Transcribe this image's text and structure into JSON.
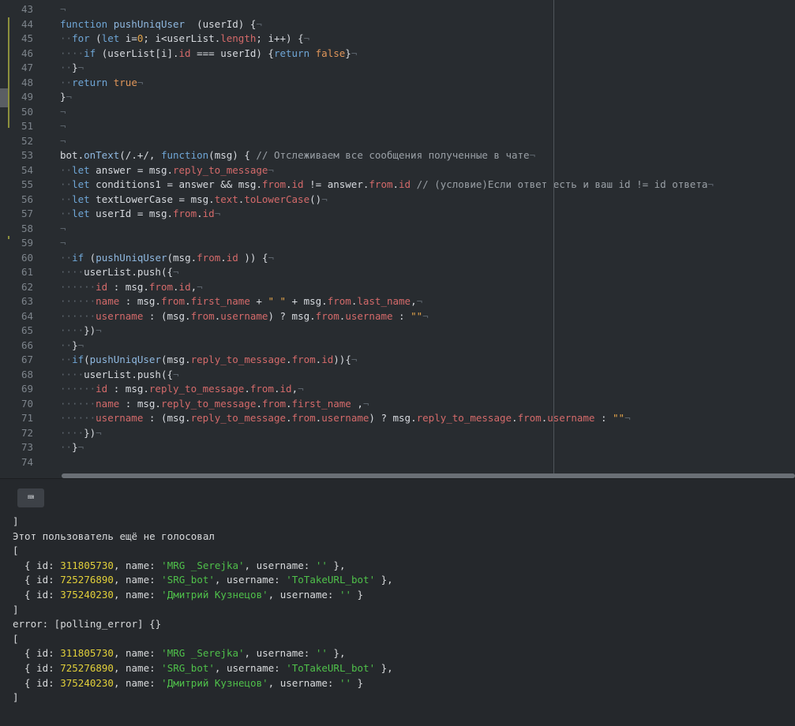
{
  "editor": {
    "lines": [
      {
        "n": "43",
        "t": [
          [
            "ws",
            "¬"
          ]
        ]
      },
      {
        "n": "44",
        "t": [
          [
            "kw",
            "function "
          ],
          [
            "fn",
            "pushUniqUser"
          ],
          [
            "",
            "  (userId) {"
          ],
          [
            "ws",
            "¬"
          ]
        ]
      },
      {
        "n": "45",
        "t": [
          [
            "ws",
            "··"
          ],
          [
            "kw",
            "for"
          ],
          [
            "",
            " ("
          ],
          [
            "kw",
            "let"
          ],
          [
            "",
            " i="
          ],
          [
            "num",
            "0"
          ],
          [
            "",
            "; i<userList."
          ],
          [
            "prop",
            "length"
          ],
          [
            "",
            "; i++) {"
          ],
          [
            "ws",
            "¬"
          ]
        ]
      },
      {
        "n": "46",
        "t": [
          [
            "ws",
            "····"
          ],
          [
            "kw",
            "if"
          ],
          [
            "",
            " (userList[i]."
          ],
          [
            "prop",
            "id"
          ],
          [
            "",
            " === userId) {"
          ],
          [
            "kw",
            "return "
          ],
          [
            "bool",
            "false"
          ],
          [
            "",
            "}"
          ],
          [
            "ws",
            "¬"
          ]
        ]
      },
      {
        "n": "47",
        "t": [
          [
            "ws",
            "··"
          ],
          [
            "",
            "}"
          ],
          [
            "ws",
            "¬"
          ]
        ]
      },
      {
        "n": "48",
        "t": [
          [
            "ws",
            "··"
          ],
          [
            "kw",
            "return "
          ],
          [
            "bool",
            "true"
          ],
          [
            "ws",
            "¬"
          ]
        ]
      },
      {
        "n": "49",
        "t": [
          [
            "",
            "}"
          ],
          [
            "ws",
            "¬"
          ]
        ]
      },
      {
        "n": "50",
        "t": [
          [
            "ws",
            "¬"
          ]
        ]
      },
      {
        "n": "51",
        "t": [
          [
            "ws",
            "¬"
          ]
        ]
      },
      {
        "n": "52",
        "t": [
          [
            "ws",
            "¬"
          ]
        ]
      },
      {
        "n": "53",
        "t": [
          [
            "",
            "bot."
          ],
          [
            "fn",
            "onText"
          ],
          [
            "",
            "(/.+/, "
          ],
          [
            "kw",
            "function"
          ],
          [
            "",
            "(msg) { "
          ],
          [
            "cmt",
            "// Отслеживаем все сообщения полученные в чате"
          ],
          [
            "ws",
            "¬"
          ]
        ]
      },
      {
        "n": "54",
        "t": [
          [
            "ws",
            "··"
          ],
          [
            "kw",
            "let"
          ],
          [
            "",
            " answer = msg."
          ],
          [
            "prop",
            "reply_to_message"
          ],
          [
            "ws",
            "¬"
          ]
        ]
      },
      {
        "n": "55",
        "t": [
          [
            "ws",
            "··"
          ],
          [
            "kw",
            "let"
          ],
          [
            "",
            " conditions1 = answer && msg."
          ],
          [
            "prop",
            "from"
          ],
          [
            "",
            "."
          ],
          [
            "prop",
            "id"
          ],
          [
            "",
            " != answer."
          ],
          [
            "prop",
            "from"
          ],
          [
            "",
            "."
          ],
          [
            "prop",
            "id"
          ],
          [
            "",
            " "
          ],
          [
            "cmt",
            "// (условие)Если ответ есть и ваш id != id ответа"
          ],
          [
            "ws",
            "¬"
          ]
        ]
      },
      {
        "n": "56",
        "t": [
          [
            "ws",
            "··"
          ],
          [
            "kw",
            "let"
          ],
          [
            "",
            " textLowerCase = msg."
          ],
          [
            "prop",
            "text"
          ],
          [
            "",
            "."
          ],
          [
            "prop",
            "toLowerCase"
          ],
          [
            "",
            "()"
          ],
          [
            "ws",
            "¬"
          ]
        ]
      },
      {
        "n": "57",
        "t": [
          [
            "ws",
            "··"
          ],
          [
            "kw",
            "let"
          ],
          [
            "",
            " userId = msg."
          ],
          [
            "prop",
            "from"
          ],
          [
            "",
            "."
          ],
          [
            "prop",
            "id"
          ],
          [
            "ws",
            "¬"
          ]
        ]
      },
      {
        "n": "58",
        "t": [
          [
            "ws",
            "¬"
          ]
        ]
      },
      {
        "n": "59",
        "t": [
          [
            "ws",
            "¬"
          ]
        ]
      },
      {
        "n": "60",
        "t": [
          [
            "ws",
            "··"
          ],
          [
            "kw",
            "if"
          ],
          [
            "",
            " ("
          ],
          [
            "fn",
            "pushUniqUser"
          ],
          [
            "",
            "(msg."
          ],
          [
            "prop",
            "from"
          ],
          [
            "",
            "."
          ],
          [
            "prop",
            "id"
          ],
          [
            "",
            " )) {"
          ],
          [
            "ws",
            "¬"
          ]
        ]
      },
      {
        "n": "61",
        "t": [
          [
            "ws",
            "····"
          ],
          [
            "",
            "userList.push({"
          ],
          [
            "ws",
            "¬"
          ]
        ]
      },
      {
        "n": "62",
        "t": [
          [
            "ws",
            "······"
          ],
          [
            "prop",
            "id"
          ],
          [
            "",
            " : msg."
          ],
          [
            "prop",
            "from"
          ],
          [
            "",
            "."
          ],
          [
            "prop",
            "id"
          ],
          [
            "",
            ","
          ],
          [
            "ws",
            "¬"
          ]
        ]
      },
      {
        "n": "63",
        "t": [
          [
            "ws",
            "······"
          ],
          [
            "prop",
            "name"
          ],
          [
            "",
            " : msg."
          ],
          [
            "prop",
            "from"
          ],
          [
            "",
            "."
          ],
          [
            "prop",
            "first_name"
          ],
          [
            "",
            " + "
          ],
          [
            "str",
            "\" \""
          ],
          [
            "",
            " + msg."
          ],
          [
            "prop",
            "from"
          ],
          [
            "",
            "."
          ],
          [
            "prop",
            "last_name"
          ],
          [
            "",
            ","
          ],
          [
            "ws",
            "¬"
          ]
        ]
      },
      {
        "n": "64",
        "t": [
          [
            "ws",
            "······"
          ],
          [
            "prop",
            "username"
          ],
          [
            "",
            " : (msg."
          ],
          [
            "prop",
            "from"
          ],
          [
            "",
            "."
          ],
          [
            "prop",
            "username"
          ],
          [
            "",
            ") ? msg."
          ],
          [
            "prop",
            "from"
          ],
          [
            "",
            "."
          ],
          [
            "prop",
            "username"
          ],
          [
            "",
            " : "
          ],
          [
            "str",
            "\"\""
          ],
          [
            "ws",
            "¬"
          ]
        ]
      },
      {
        "n": "65",
        "t": [
          [
            "ws",
            "····"
          ],
          [
            "",
            "})"
          ],
          [
            "ws",
            "¬"
          ]
        ]
      },
      {
        "n": "66",
        "t": [
          [
            "ws",
            "··"
          ],
          [
            "",
            "}"
          ],
          [
            "ws",
            "¬"
          ]
        ]
      },
      {
        "n": "67",
        "t": [
          [
            "ws",
            "··"
          ],
          [
            "kw",
            "if"
          ],
          [
            "",
            "("
          ],
          [
            "fn",
            "pushUniqUser"
          ],
          [
            "",
            "(msg."
          ],
          [
            "prop",
            "reply_to_message"
          ],
          [
            "",
            "."
          ],
          [
            "prop",
            "from"
          ],
          [
            "",
            "."
          ],
          [
            "prop",
            "id"
          ],
          [
            "",
            "))"
          ],
          [
            "",
            "{"
          ],
          [
            "ws",
            "¬"
          ]
        ]
      },
      {
        "n": "68",
        "t": [
          [
            "ws",
            "····"
          ],
          [
            "",
            "userList.push({"
          ],
          [
            "ws",
            "¬"
          ]
        ]
      },
      {
        "n": "69",
        "t": [
          [
            "ws",
            "······"
          ],
          [
            "prop",
            "id"
          ],
          [
            "",
            " : msg."
          ],
          [
            "prop",
            "reply_to_message"
          ],
          [
            "",
            "."
          ],
          [
            "prop",
            "from"
          ],
          [
            "",
            "."
          ],
          [
            "prop",
            "id"
          ],
          [
            "",
            ","
          ],
          [
            "ws",
            "¬"
          ]
        ]
      },
      {
        "n": "70",
        "t": [
          [
            "ws",
            "······"
          ],
          [
            "prop",
            "name"
          ],
          [
            "",
            " : msg."
          ],
          [
            "prop",
            "reply_to_message"
          ],
          [
            "",
            "."
          ],
          [
            "prop",
            "from"
          ],
          [
            "",
            "."
          ],
          [
            "prop",
            "first_name"
          ],
          [
            "",
            " ,"
          ],
          [
            "ws",
            "¬"
          ]
        ]
      },
      {
        "n": "71",
        "t": [
          [
            "ws",
            "······"
          ],
          [
            "prop",
            "username"
          ],
          [
            "",
            " : (msg."
          ],
          [
            "prop",
            "reply_to_message"
          ],
          [
            "",
            "."
          ],
          [
            "prop",
            "from"
          ],
          [
            "",
            "."
          ],
          [
            "prop",
            "username"
          ],
          [
            "",
            ") ? msg."
          ],
          [
            "prop",
            "reply_to_message"
          ],
          [
            "",
            "."
          ],
          [
            "prop",
            "from"
          ],
          [
            "",
            "."
          ],
          [
            "prop",
            "username"
          ],
          [
            "",
            " : "
          ],
          [
            "str",
            "\"\""
          ],
          [
            "ws",
            "¬"
          ]
        ]
      },
      {
        "n": "72",
        "t": [
          [
            "ws",
            "····"
          ],
          [
            "",
            "})"
          ],
          [
            "ws",
            "¬"
          ]
        ]
      },
      {
        "n": "73",
        "t": [
          [
            "ws",
            "··"
          ],
          [
            "",
            "}"
          ],
          [
            "ws",
            "¬"
          ]
        ]
      },
      {
        "n": "74",
        "t": []
      }
    ]
  },
  "terminal": {
    "keyboard_icon": "⌨",
    "lines": [
      [
        [
          "",
          "]"
        ]
      ],
      [
        [
          "",
          "Этот пользователь ещё не голосовал"
        ]
      ],
      [
        [
          "",
          "["
        ]
      ],
      [
        [
          "",
          "  { id: "
        ],
        [
          "t-num",
          "311805730"
        ],
        [
          "",
          ", name: "
        ],
        [
          "t-str",
          "'MRG _Serejka'"
        ],
        [
          "",
          ", username: "
        ],
        [
          "t-str",
          "''"
        ],
        [
          "",
          " },"
        ]
      ],
      [
        [
          "",
          "  { id: "
        ],
        [
          "t-num",
          "725276890"
        ],
        [
          "",
          ", name: "
        ],
        [
          "t-str",
          "'SRG_bot'"
        ],
        [
          "",
          ", username: "
        ],
        [
          "t-str",
          "'ToTakeURL_bot'"
        ],
        [
          "",
          " },"
        ]
      ],
      [
        [
          "",
          "  { id: "
        ],
        [
          "t-num",
          "375240230"
        ],
        [
          "",
          ", name: "
        ],
        [
          "t-str",
          "'Дмитрий Кузнецов'"
        ],
        [
          "",
          ", username: "
        ],
        [
          "t-str",
          "''"
        ],
        [
          "",
          " }"
        ]
      ],
      [
        [
          "",
          "]"
        ]
      ],
      [
        [
          "",
          "error: [polling_error] {}"
        ]
      ],
      [
        [
          "",
          "["
        ]
      ],
      [
        [
          "",
          "  { id: "
        ],
        [
          "t-num",
          "311805730"
        ],
        [
          "",
          ", name: "
        ],
        [
          "t-str",
          "'MRG _Serejka'"
        ],
        [
          "",
          ", username: "
        ],
        [
          "t-str",
          "''"
        ],
        [
          "",
          " },"
        ]
      ],
      [
        [
          "",
          "  { id: "
        ],
        [
          "t-num",
          "725276890"
        ],
        [
          "",
          ", name: "
        ],
        [
          "t-str",
          "'SRG_bot'"
        ],
        [
          "",
          ", username: "
        ],
        [
          "t-str",
          "'ToTakeURL_bot'"
        ],
        [
          "",
          " },"
        ]
      ],
      [
        [
          "",
          "  { id: "
        ],
        [
          "t-num",
          "375240230"
        ],
        [
          "",
          ", name: "
        ],
        [
          "t-str",
          "'Дмитрий Кузнецов'"
        ],
        [
          "",
          ", username: "
        ],
        [
          "t-str",
          "''"
        ],
        [
          "",
          " }"
        ]
      ],
      [
        [
          "",
          "]"
        ]
      ]
    ]
  }
}
